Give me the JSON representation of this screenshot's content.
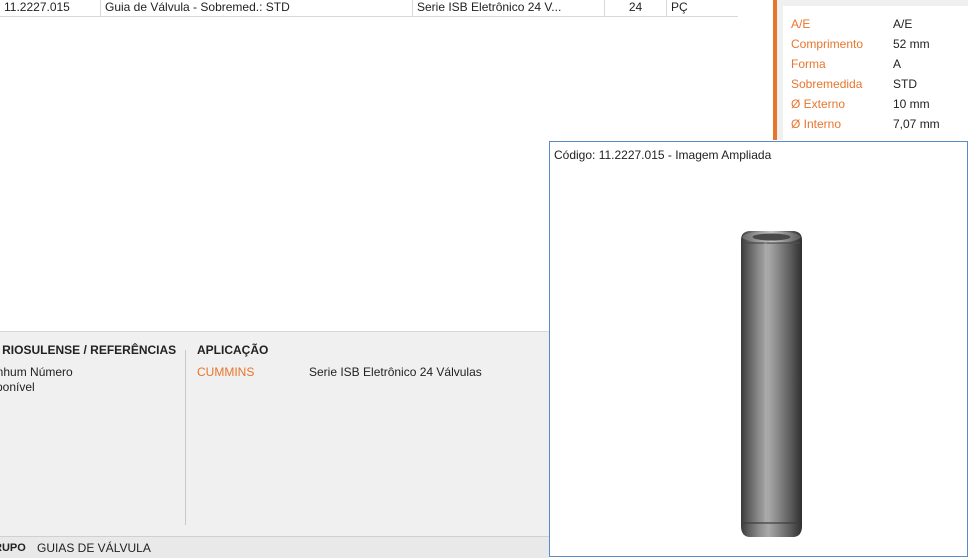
{
  "table": {
    "row": {
      "code": "11.2227.015",
      "description": "Guia de Válvula - Sobremed.: STD",
      "application": "Serie ISB Eletrônico 24 V...",
      "quantity": "24",
      "unit": "PÇ"
    }
  },
  "specs": [
    {
      "label": "A/E",
      "value": "A/E"
    },
    {
      "label": "Comprimento",
      "value": "52 mm"
    },
    {
      "label": "Forma",
      "value": "A"
    },
    {
      "label": "Sobremedida",
      "value": "STD"
    },
    {
      "label": "Ø Externo",
      "value": "10 mm"
    },
    {
      "label": "Ø Interno",
      "value": "7,07 mm"
    }
  ],
  "references": {
    "title": "° RIOSULENSE / REFERÊNCIAS",
    "line1": "enhum Número",
    "line2": "sponível"
  },
  "application": {
    "title": "APLICAÇÃO",
    "brand": "CUMMINS",
    "description": "Serie ISB Eletrônico 24 Válvulas"
  },
  "group": {
    "label": "RUPO",
    "value": "GUIAS DE VÁLVULA"
  },
  "image_window": {
    "caption": "Código: 11.2227.015 - Imagem Ampliada"
  },
  "colors": {
    "accent": "#e8752d",
    "window_border": "#5a8ac7"
  }
}
